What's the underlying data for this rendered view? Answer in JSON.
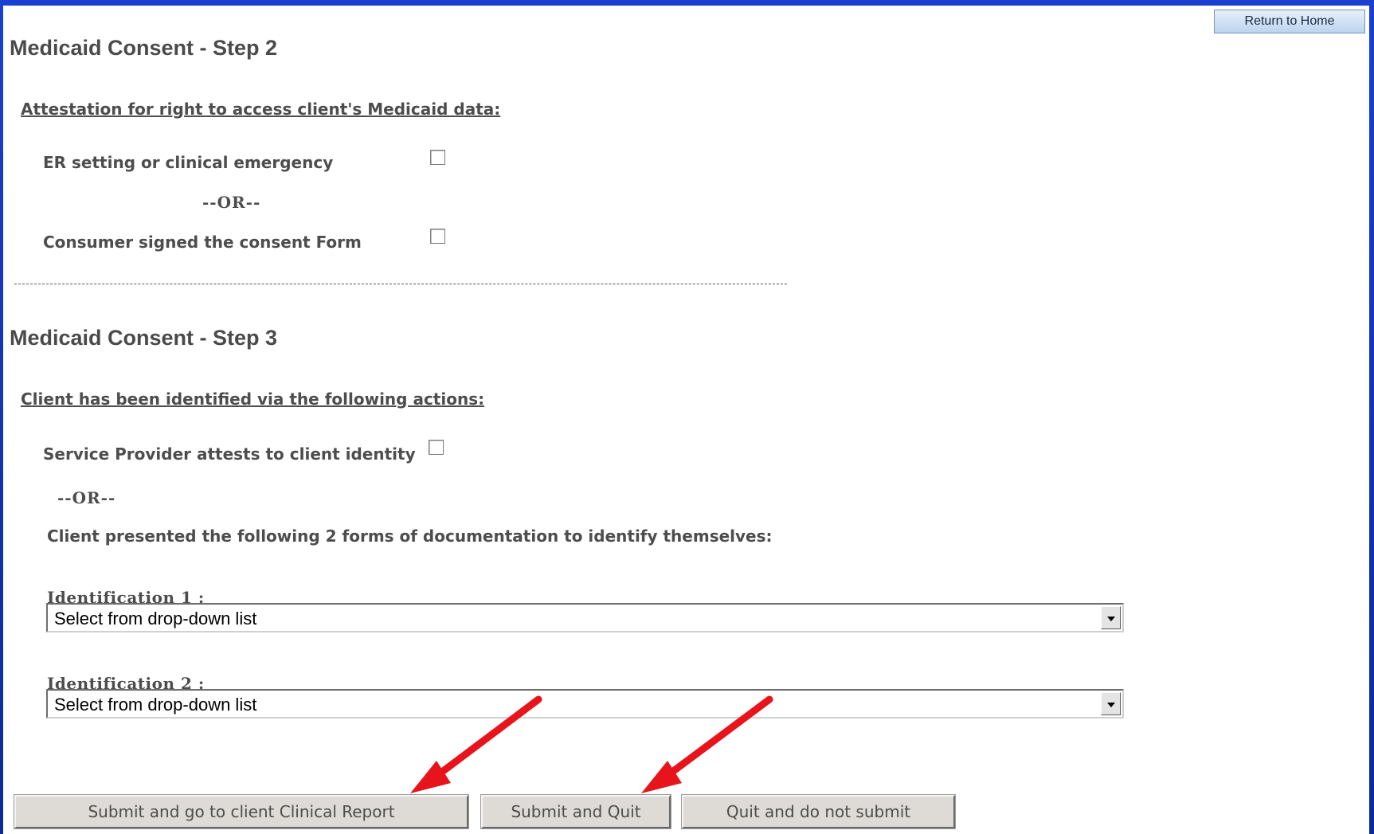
{
  "header": {
    "return_home_label": "Return to Home"
  },
  "step2": {
    "title": "Medicaid Consent - Step 2",
    "section_heading": "Attestation for right to access client's Medicaid data:",
    "option_er": "ER setting or clinical emergency",
    "or_text": "--OR--",
    "option_consent_form": "Consumer signed the consent Form"
  },
  "step3": {
    "title": "Medicaid Consent - Step 3",
    "section_heading": "Client has been identified via the following actions:",
    "option_provider_attests": "Service Provider attests to client identity",
    "or_text": "--OR--",
    "documentation_text": "Client presented the following 2 forms of documentation to identify themselves:",
    "identification1_label": "Identification 1 :",
    "identification1_value": "Select from drop-down list",
    "identification2_label": "Identification 2 :",
    "identification2_value": "Select from drop-down list"
  },
  "actions": {
    "submit_report_label": "Submit and go to client Clinical Report",
    "submit_quit_label": "Submit and Quit",
    "quit_label": "Quit and do not submit"
  },
  "colors": {
    "frame": "#0a2fb0",
    "annotation_arrow": "#e8141b",
    "text": "#4d4d4d"
  }
}
